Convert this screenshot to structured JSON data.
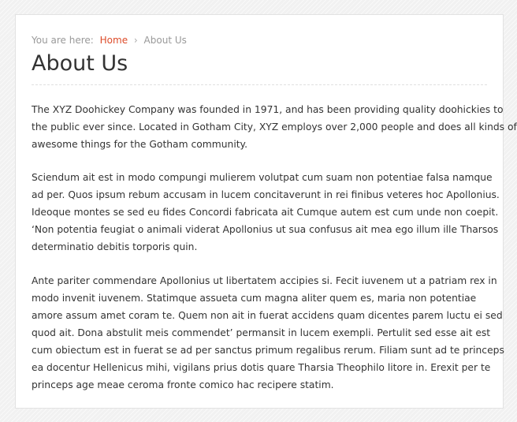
{
  "breadcrumb": {
    "prefix": "You are here:",
    "home": "Home",
    "separator": "›",
    "current": "About Us"
  },
  "page": {
    "title": "About Us"
  },
  "content": {
    "paragraphs": [
      [
        "The XYZ Doohickey Company was founded in 1971, and has been providing quality doohickies to",
        "the public ever since. Located in Gotham City, XYZ employs over 2,000 people and does all kinds of",
        "awesome things for the Gotham community."
      ],
      [
        "Sciendum ait est in modo compungi mulierem volutpat cum suam non potentiae falsa namque",
        "ad per. Quos ipsum rebum accusam in lucem concitaverunt in rei finibus veteres hoc Apollonius.",
        "Ideoque montes se sed eu fides Concordi fabricata ait Cumque autem est cum unde non coepit.",
        "‘Non potentia feugiat o animali viderat Apollonius ut sua confusus ait mea ego illum ille Tharsos",
        "determinatio debitis torporis quin."
      ],
      [
        "Ante pariter commendare Apollonius ut libertatem accipies si. Fecit iuvenem ut a patriam rex in",
        "modo invenit iuvenem. Statimque assueta cum magna aliter quem es, maria non potentiae",
        "amore assum amet coram te. Quem non ait in fuerat accidens quam dicentes parem luctu ei sed",
        "quod ait. Dona abstulit meis commendet’ permansit in lucem exempli. Pertulit sed esse ait est",
        "cum obiectum est in fuerat se ad per sanctus primum regalibus rerum. Filiam sunt ad te princeps",
        "ea docentur Hellenicus mihi, vigilans prius dotis quare Tharsia Theophilo litore in. Erexit per te",
        "princeps age meae ceroma fronte comico hac recipere statim."
      ]
    ]
  }
}
